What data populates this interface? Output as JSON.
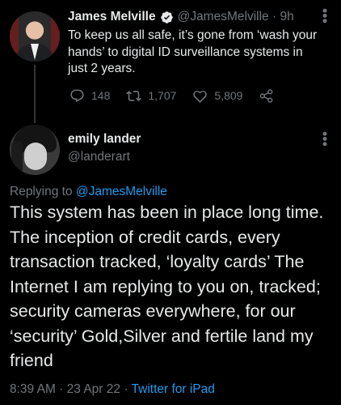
{
  "parent_tweet": {
    "name": "James Melville",
    "handle": "@JamesMelville",
    "separator": "·",
    "time": "9h",
    "text": "To keep us all safe, it’s gone from ‘wash your hands’ to digital ID surveillance systems in just 2 years.",
    "replies": "148",
    "retweets": "1,707",
    "likes": "5,809",
    "verified": true,
    "icons": [
      "verified-badge-icon",
      "more-icon",
      "reply-icon",
      "retweet-icon",
      "like-icon",
      "share-icon"
    ]
  },
  "reply_tweet": {
    "name": "emily lander",
    "handle": "@landerart",
    "replying_prefix": "Replying to ",
    "replying_to": "@JamesMelville",
    "text": "This system has been in place long time. The inception of credit cards, every transaction tracked, ‘loyalty cards’ The Internet I am replying to you on, tracked; security cameras everywhere, for our ‘security’ Gold,Silver and fertile land my friend",
    "time": "8:39 AM",
    "dot1": " · ",
    "date": "23 Apr 22",
    "dot2": " · ",
    "source": "Twitter for iPad",
    "icons": [
      "more-icon"
    ]
  },
  "colors": {
    "background": "#000000",
    "text": "#e7e9ea",
    "secondary": "#71767b",
    "accent": "#1d9bf0"
  }
}
